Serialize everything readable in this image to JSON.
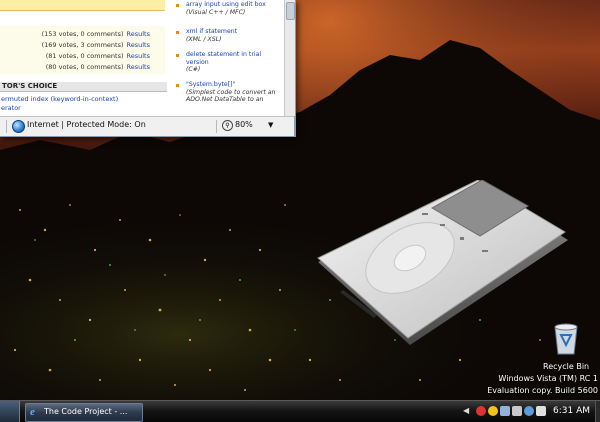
{
  "browser": {
    "votes": [
      {
        "text": "(153 votes, 0 comments)",
        "link": "Results"
      },
      {
        "text": "(169 votes, 3 comments)",
        "link": "Results"
      },
      {
        "text": "(81 votes, 0 comments)",
        "link": "Results"
      },
      {
        "text": "(80 votes, 0 comments)",
        "link": "Results"
      }
    ],
    "editors_choice_header": "TOR'S CHOICE",
    "editors_links": [
      "ermuted index (keyword-in-context)",
      "erator"
    ],
    "news": [
      {
        "title": "array input using edit box",
        "sub": "(Visual C++ / MFC)"
      },
      {
        "title": "xml if statement",
        "sub": "(XML / XSL)"
      },
      {
        "title": "delete statement in trial version",
        "sub": "(C#)"
      },
      {
        "title": "\"System.byte[]\"",
        "sub": "(Simplest code to convert an ADO.Net DataTable to an"
      }
    ],
    "status": {
      "zone": "Internet | Protected Mode: On",
      "zoom": "80%"
    }
  },
  "desktop": {
    "recycle_bin_label": "Recycle Bin",
    "watermark_line1": "Windows Vista (TM) RC 1",
    "watermark_line2": "Evaluation copy. Build 5600"
  },
  "taskbar": {
    "task_label": "The Code Project - ...",
    "clock": "6:31 AM"
  },
  "colors": {
    "link": "#1a44b8",
    "editor_header_bg": "#e6e6e6",
    "header_yellow": "#fcefa5",
    "taskbar_dark": "#050505"
  }
}
